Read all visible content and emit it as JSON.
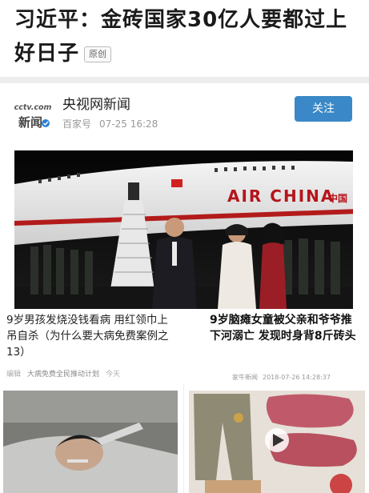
{
  "article": {
    "title": "习近平：金砖国家30亿人要都过上好日子",
    "badge": "原创"
  },
  "author": {
    "name": "央视网新闻",
    "logo_text_top": "cctv.com",
    "logo_text_bottom": "新闻",
    "platform": "百家号",
    "date": "07-25 16:28",
    "follow_label": "关注",
    "follow_color": "#3a88c7"
  },
  "hero_image": {
    "plane_text": "AIR CHINA",
    "plane_text_cn": "中国"
  },
  "related": [
    {
      "title": "9岁男孩发烧没钱看病 用红领巾上吊自杀（为什么要大病免费案例之13）",
      "meta": [
        "编辑",
        "大病免费全民推动计划",
        "今天"
      ]
    },
    {
      "title": "9岁脑瘫女童被父亲和爷爷推下河溺亡 发现时身背8斤砖头",
      "meta": [
        "家牛新闻",
        "2018-07-26 14:28:37"
      ]
    }
  ]
}
